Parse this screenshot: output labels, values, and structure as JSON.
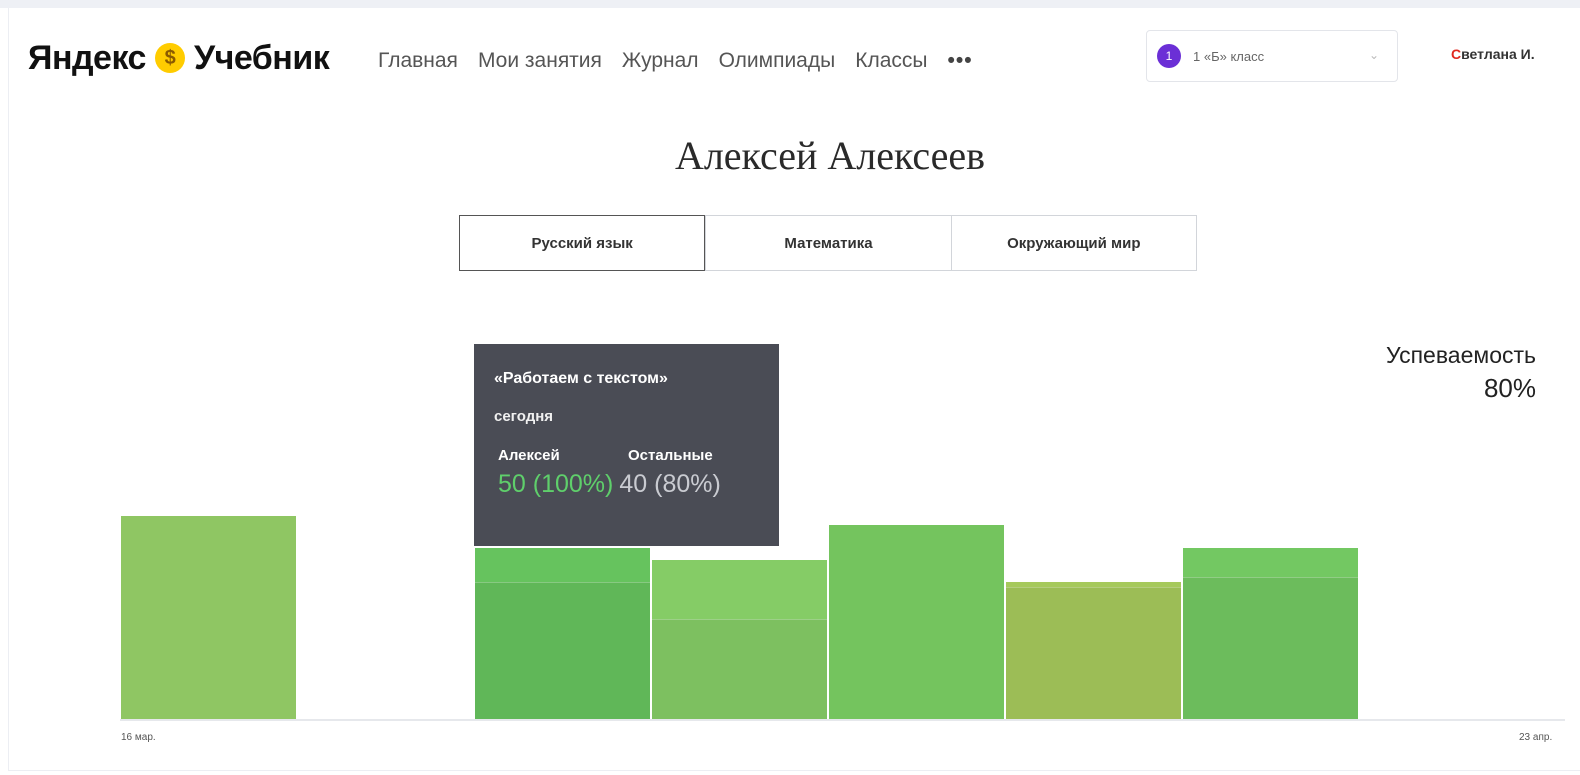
{
  "header": {
    "logo_left": "Яндекс",
    "logo_coin": "$",
    "logo_right": "Учебник",
    "nav": [
      "Главная",
      "Мои занятия",
      "Журнал",
      "Олимпиады",
      "Классы"
    ],
    "more": "•••",
    "class_selector": {
      "number": "1",
      "label": "1 «Б» класс",
      "chevron": "⌄"
    },
    "user_initial": "С",
    "user_rest": "ветлана И."
  },
  "student_name": "Алексей Алексеев",
  "tabs": [
    {
      "label": "Русский язык",
      "active": true
    },
    {
      "label": "Математика",
      "active": false
    },
    {
      "label": "Окружающий мир",
      "active": false
    }
  ],
  "performance": {
    "label": "Успеваемость",
    "value": "80%"
  },
  "tooltip": {
    "title": "«Работаем с текстом»",
    "when": "сегодня",
    "col1": "Алексей",
    "col2": "Остальные",
    "val1": "50 (100%)",
    "val2": "40 (80%)"
  },
  "chart_data": {
    "type": "bar",
    "x_start_label": "16 мар.",
    "x_end_label": "23 апр.",
    "ylim": [
      0,
      1
    ],
    "columns": [
      {
        "slot": 0,
        "student": 0.83
      },
      {
        "slot": 2,
        "student": 0.7,
        "others": 0.56
      },
      {
        "slot": 3,
        "student": 0.65,
        "others": 0.41
      },
      {
        "slot": 4,
        "student": 0.79
      },
      {
        "slot": 5,
        "student": 0.56,
        "others": 0.54
      },
      {
        "slot": 6,
        "student": 0.7,
        "others": 0.58
      }
    ],
    "colors": {
      "bar_1": "#8fc663",
      "bar_2": "#66c35e",
      "bar_3": "#85cc66",
      "bar_4": "#74c45e",
      "bar_5": "#a6c95c",
      "bar_6": "#73c862",
      "overlay": "rgba(0,0,0,0.06)"
    }
  }
}
